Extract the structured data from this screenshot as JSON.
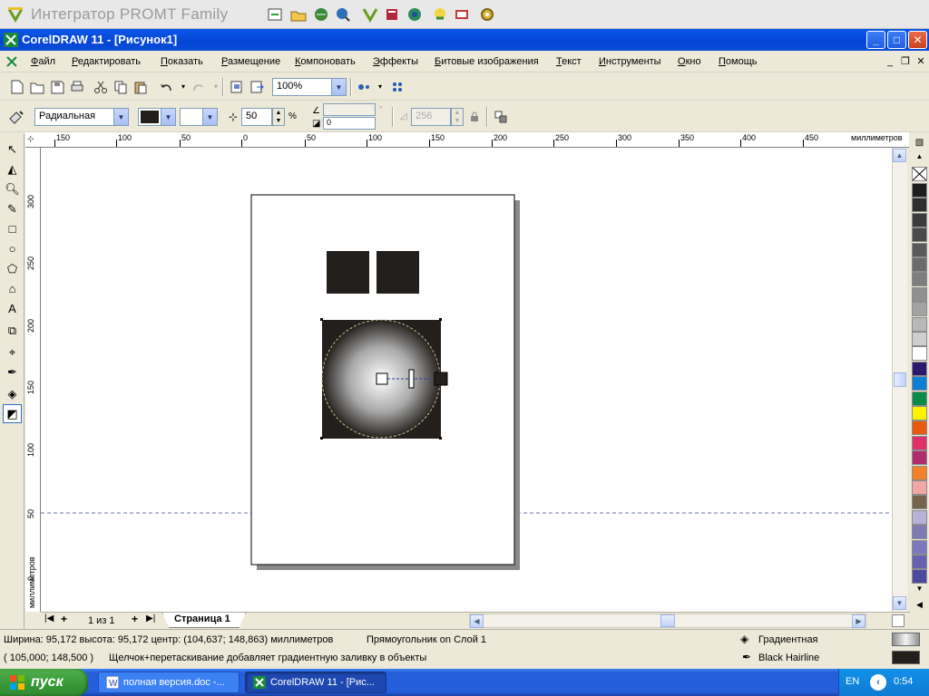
{
  "promt": {
    "title": "Интегратор PROMT Family"
  },
  "window": {
    "title": "CorelDRAW 11 - [Рисунок1]",
    "minimize": "_",
    "maximize": "□",
    "close": "✕",
    "mdi_minimize": "_",
    "mdi_restore": "❐",
    "mdi_close": "✕"
  },
  "menu": [
    "Файл",
    "Редактировать",
    "Показать",
    "Размещение",
    "Компоновать",
    "Эффекты",
    "Битовые изображения",
    "Текст",
    "Инструменты",
    "Окно",
    "Помощь"
  ],
  "toolbar": {
    "zoom": "100%"
  },
  "property_bar": {
    "fill_type": "Радиальная",
    "midpoint": "50",
    "midpoint_unit": "%",
    "angle": "",
    "offset": "0",
    "steps": "256"
  },
  "ruler": {
    "unit_label": "миллиметров",
    "h_ticks": [
      "150",
      "100",
      "50",
      "0",
      "50",
      "100",
      "150",
      "200",
      "250",
      "300",
      "350",
      "400",
      "450"
    ],
    "v_ticks": [
      "300",
      "250",
      "200",
      "150",
      "100",
      "50",
      "0"
    ]
  },
  "page_tabs": {
    "counter": "1 из 1",
    "active_tab": "Страница 1"
  },
  "status": {
    "dimensions": "Ширина: 95,172  высота: 95,172  центр: (104,637; 148,863)  миллиметров",
    "object_info": "Прямоугольник on Слой 1",
    "cursor": "( 105,000; 148,500 )",
    "hint": "Щелчок+перетаскивание добавляет градиентную заливку в объекты",
    "fill_label": "Градиентная",
    "outline_label": "Black  Hairline"
  },
  "taskbar": {
    "start_label": "пуск",
    "tasks": [
      "полная версия.doc -...",
      "CorelDRAW 11 - [Рис..."
    ],
    "lang": "EN",
    "time": "0:54"
  },
  "palette": {
    "colors": [
      "#1e1e1e",
      "#2e2e2e",
      "#3c3c3c",
      "#4a4a4a",
      "#5a5a5a",
      "#6b6b6b",
      "#7d7d7d",
      "#909090",
      "#a3a3a3",
      "#b8b8b8",
      "#cecece",
      "#ffffff",
      "#2b1a6e",
      "#0e7ed3",
      "#0b8a4a",
      "#fff200",
      "#e85a10",
      "#e0306a",
      "#b02c6c",
      "#f3812a",
      "#f2a7a7",
      "#75634b",
      "#b7b2d8",
      "#7f7ab4",
      "#7c78c0",
      "#6661b0",
      "#4b4aa0"
    ]
  },
  "colors": {
    "object_fill": "#231f1c",
    "gradient_center": "#ffffff",
    "gradient_edge": "#231f1c"
  }
}
